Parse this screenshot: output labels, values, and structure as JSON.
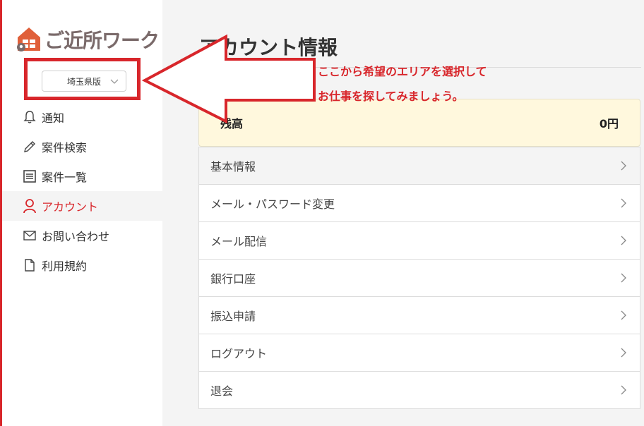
{
  "brand": {
    "name": "ご近所ワーク",
    "accent": "#d8262b",
    "logo_icon": "house-pin-icon"
  },
  "area_select": {
    "selected": "埼玉県版"
  },
  "nav": {
    "items": [
      {
        "label": "通知",
        "icon": "bell-icon"
      },
      {
        "label": "案件検索",
        "icon": "pencil-icon"
      },
      {
        "label": "案件一覧",
        "icon": "list-icon"
      },
      {
        "label": "アカウント",
        "icon": "person-icon",
        "active": true
      },
      {
        "label": "お問い合わせ",
        "icon": "mail-icon"
      },
      {
        "label": "利用規約",
        "icon": "document-icon"
      }
    ]
  },
  "main": {
    "title": "アカウント情報",
    "balance": {
      "label": "残高",
      "value": "0円",
      "bg": "#fff8dd"
    },
    "menu": [
      {
        "label": "基本情報"
      },
      {
        "label": "メール・パスワード変更"
      },
      {
        "label": "メール配信"
      },
      {
        "label": "銀行口座"
      },
      {
        "label": "振込申請"
      },
      {
        "label": "ログアウト"
      },
      {
        "label": "退会"
      }
    ]
  },
  "annotation": {
    "line1": "ここから希望のエリアを選択して",
    "line2": "お仕事を探してみましょう。",
    "color": "#d8262b"
  }
}
